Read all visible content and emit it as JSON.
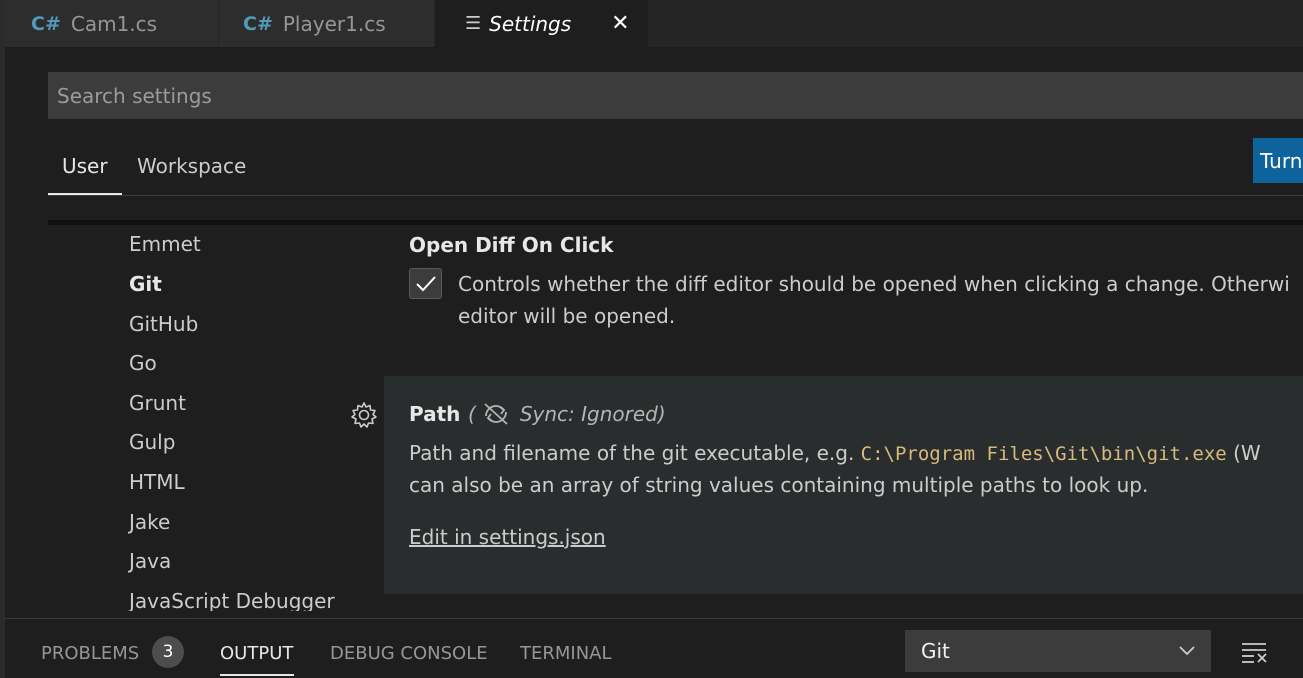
{
  "tabs": [
    {
      "icon": "C#",
      "label": "Cam1.cs"
    },
    {
      "icon": "C#",
      "label": "Player1.cs"
    },
    {
      "label": "Settings",
      "close": "✕"
    }
  ],
  "search": {
    "placeholder": "Search settings"
  },
  "scope_tabs": {
    "user": "User",
    "workspace": "Workspace"
  },
  "turn_on_button": {
    "label": "Turn"
  },
  "toc": {
    "items": [
      "Emmet",
      "Git",
      "GitHub",
      "Go",
      "Grunt",
      "Gulp",
      "HTML",
      "Jake",
      "Java",
      "JavaScript Debugger"
    ],
    "active": "Git"
  },
  "settings": {
    "open_diff": {
      "title": "Open Diff On Click",
      "desc_line1": "Controls whether the diff editor should be opened when clicking a change. Otherwi",
      "desc_line2": "editor will be opened.",
      "checked": true
    },
    "path": {
      "title": "Path",
      "sync": "Sync: Ignored)",
      "sync_open": "(",
      "desc_pre": "Path and filename of the git executable, e.g. ",
      "desc_code": "C:\\Program Files\\Git\\bin\\git.exe",
      "desc_post": " (W",
      "desc_line2": "can also be an array of string values containing multiple paths to look up.",
      "link": "Edit in settings.json"
    }
  },
  "panel": {
    "problems": "PROBLEMS",
    "problems_count": "3",
    "output": "OUTPUT",
    "debug_console": "DEBUG CONSOLE",
    "terminal": "TERMINAL",
    "output_channel": "Git"
  },
  "colors": {
    "accent": "#0e639c",
    "code": "#d7ba7d",
    "csharp": "#519aba"
  }
}
